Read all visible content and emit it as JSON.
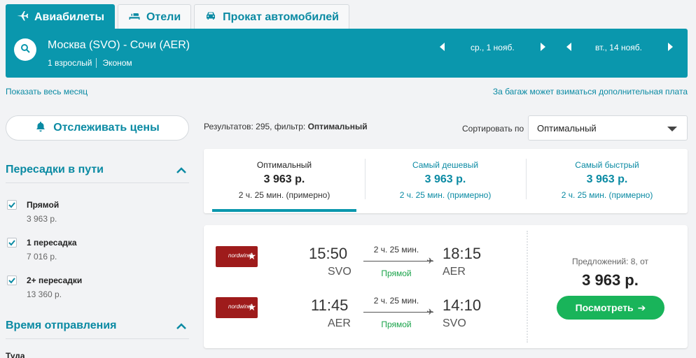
{
  "tabs": [
    {
      "label": "Авиабилеты",
      "icon": "plane-icon",
      "active": true
    },
    {
      "label": "Отели",
      "icon": "bed-icon",
      "active": false
    },
    {
      "label": "Прокат автомобилей",
      "icon": "car-icon",
      "active": false
    }
  ],
  "search": {
    "route": "Москва (SVO) - Сочи (AER)",
    "passengers": "1 взрослый",
    "cabin": "Эконом",
    "depart_date": "ср., 1 нояб.",
    "return_date": "вт., 14 нояб."
  },
  "links": {
    "show_month": "Показать весь месяц",
    "baggage_note": "За багаж может взиматься дополнительная плата"
  },
  "sidebar": {
    "track_prices": "Отслеживать цены",
    "stops_title": "Пересадки в пути",
    "stops": [
      {
        "label": "Прямой",
        "price": "3 963 р.",
        "checked": true
      },
      {
        "label": "1 пересадка",
        "price": "7 016 р.",
        "checked": true
      },
      {
        "label": "2+ пересадки",
        "price": "13 360 р.",
        "checked": true
      }
    ],
    "departure_title": "Время отправления",
    "departure_sub": "Туда"
  },
  "results": {
    "prefix": "Результатов: 295, фильтр: ",
    "filter": "Оптимальный",
    "sort_label": "Сортировать по",
    "sort_value": "Оптимальный"
  },
  "sort_tabs": [
    {
      "title": "Оптимальный",
      "price": "3 963 р.",
      "duration": "2 ч. 25 мин. (примерно)"
    },
    {
      "title": "Самый дешевый",
      "price": "3 963 р.",
      "duration": "2 ч. 25 мин. (примерно)"
    },
    {
      "title": "Самый быстрый",
      "price": "3 963 р.",
      "duration": "2 ч. 25 мин. (примерно)"
    }
  ],
  "ticket": {
    "legs": [
      {
        "airline": "nordwind",
        "dep_time": "15:50",
        "dep_code": "SVO",
        "duration": "2 ч. 25 мин.",
        "stops": "Прямой",
        "arr_time": "18:15",
        "arr_code": "AER"
      },
      {
        "airline": "nordwind",
        "dep_time": "11:45",
        "dep_code": "AER",
        "duration": "2 ч. 25 мин.",
        "stops": "Прямой",
        "arr_time": "14:10",
        "arr_code": "SVO"
      }
    ],
    "offers": "Предложений: 8, от",
    "price": "3 963 р.",
    "button": "Посмотреть"
  },
  "colors": {
    "accent": "#0a97ad",
    "green": "#19b45a",
    "airline": "#9e1b1b"
  }
}
